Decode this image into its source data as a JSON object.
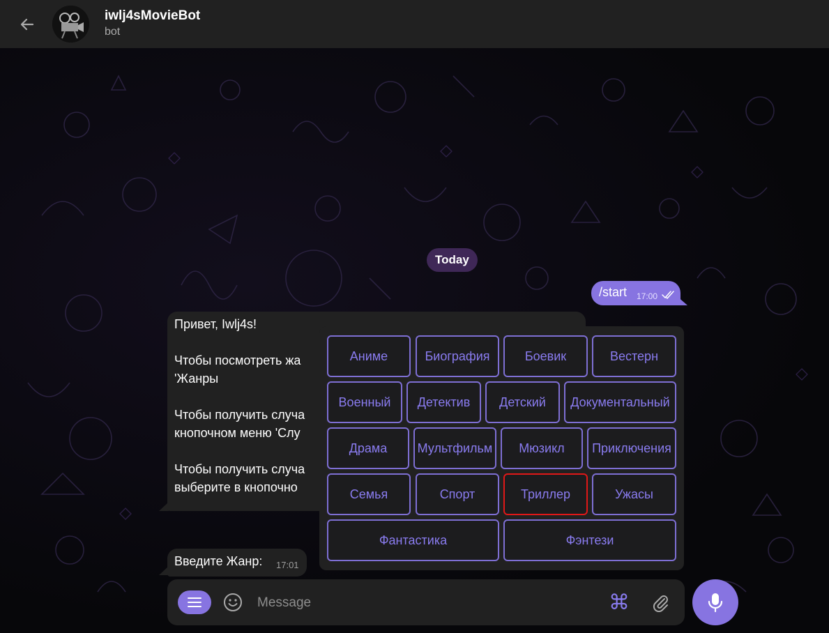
{
  "header": {
    "title": "iwlj4sMovieBot",
    "subtitle": "bot"
  },
  "chat": {
    "date_label": "Today",
    "outgoing": {
      "text": "/start",
      "time": "17:00"
    },
    "incoming_main": {
      "lines": [
        "Привет, Iwlj4s!",
        "Чтобы посмотреть жа",
        "'Жанры",
        "Чтобы получить случа",
        "кнопочном меню 'Слу",
        "Чтобы получить случа",
        "выберите в кнопочно"
      ]
    },
    "incoming_prompt": {
      "text": "Введите Жанр:",
      "time": "17:01"
    }
  },
  "keyboard": {
    "rows": [
      [
        "Аниме",
        "Биография",
        "Боевик",
        "Вестерн"
      ],
      [
        "Военный",
        "Детектив",
        "Детский",
        "Документальный"
      ],
      [
        "Драма",
        "Мультфильм",
        "Мюзикл",
        "Приключения"
      ],
      [
        "Семья",
        "Спорт",
        "Триллер",
        "Ужасы"
      ],
      [
        "Фантастика",
        "Фэнтези"
      ]
    ],
    "selected": "Триллер"
  },
  "composer": {
    "placeholder": "Message"
  },
  "colors": {
    "accent": "#8774e1",
    "button_border": "#7e6fd4",
    "selected_border": "#e01818",
    "bubble": "#212121"
  },
  "icons": {
    "back": "arrow-left-icon",
    "menu": "menu-icon",
    "emoji": "smiley-icon",
    "commands": "command-icon",
    "attach": "paperclip-icon",
    "mic": "microphone-icon"
  }
}
